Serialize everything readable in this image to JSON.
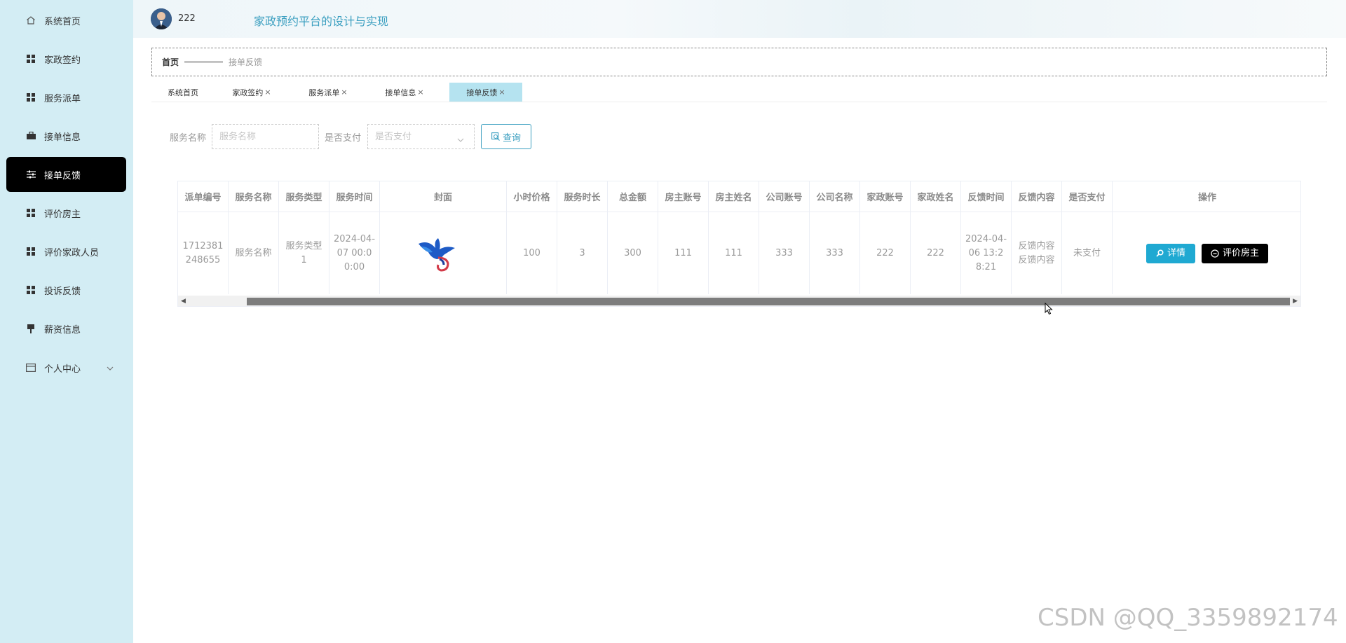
{
  "sidebar": {
    "items": [
      {
        "label": "系统首页",
        "icon": "home-icon"
      },
      {
        "label": "家政签约",
        "icon": "grid-icon"
      },
      {
        "label": "服务派单",
        "icon": "grid-icon"
      },
      {
        "label": "接单信息",
        "icon": "briefcase-icon"
      },
      {
        "label": "接单反馈",
        "icon": "sliders-icon",
        "active": true
      },
      {
        "label": "评价房主",
        "icon": "grid-icon"
      },
      {
        "label": "评价家政人员",
        "icon": "grid-icon"
      },
      {
        "label": "投诉反馈",
        "icon": "grid-icon"
      },
      {
        "label": "薪资信息",
        "icon": "pin-icon"
      },
      {
        "label": "个人中心",
        "icon": "card-icon"
      }
    ]
  },
  "header": {
    "username": "222",
    "title": "家政预约平台的设计与实现"
  },
  "breadcrumb": {
    "home": "首页",
    "current": "接单反馈"
  },
  "tags": [
    {
      "label": "系统首页",
      "closable": false
    },
    {
      "label": "家政签约",
      "closable": true
    },
    {
      "label": "服务派单",
      "closable": true
    },
    {
      "label": "接单信息",
      "closable": true
    },
    {
      "label": "接单反馈",
      "closable": true,
      "active": true
    }
  ],
  "tag_close": "×",
  "search": {
    "service_name_label": "服务名称",
    "service_name_placeholder": "服务名称",
    "paid_label": "是否支付",
    "paid_placeholder": "是否支付",
    "query_label": "查询"
  },
  "table": {
    "headers": [
      "派单编号",
      "服务名称",
      "服务类型",
      "服务时间",
      "封面",
      "小时价格",
      "服务时长",
      "总金额",
      "房主账号",
      "房主姓名",
      "公司账号",
      "公司名称",
      "家政账号",
      "家政姓名",
      "反馈时间",
      "反馈内容",
      "是否支付",
      "操作"
    ],
    "rows": [
      {
        "cells": [
          "1712381248655",
          "服务名称",
          "服务类型1",
          "2024-04-07 00:00:00",
          "",
          "100",
          "3",
          "300",
          "111",
          "111",
          "333",
          "333",
          "222",
          "222",
          "2024-04-06 13:28:21",
          "反馈内容反馈内容",
          "未支付",
          ""
        ],
        "detail_label": "详情",
        "rate_label": "评价房主"
      }
    ]
  },
  "watermark": "CSDN @QQ_3359892174",
  "colors": {
    "sidebar_bg": "#d3edf4",
    "active_bg": "#000000",
    "accent": "#3b9fc0",
    "detail_btn": "#1fa9d2",
    "tag_active": "#b5e3f0"
  }
}
